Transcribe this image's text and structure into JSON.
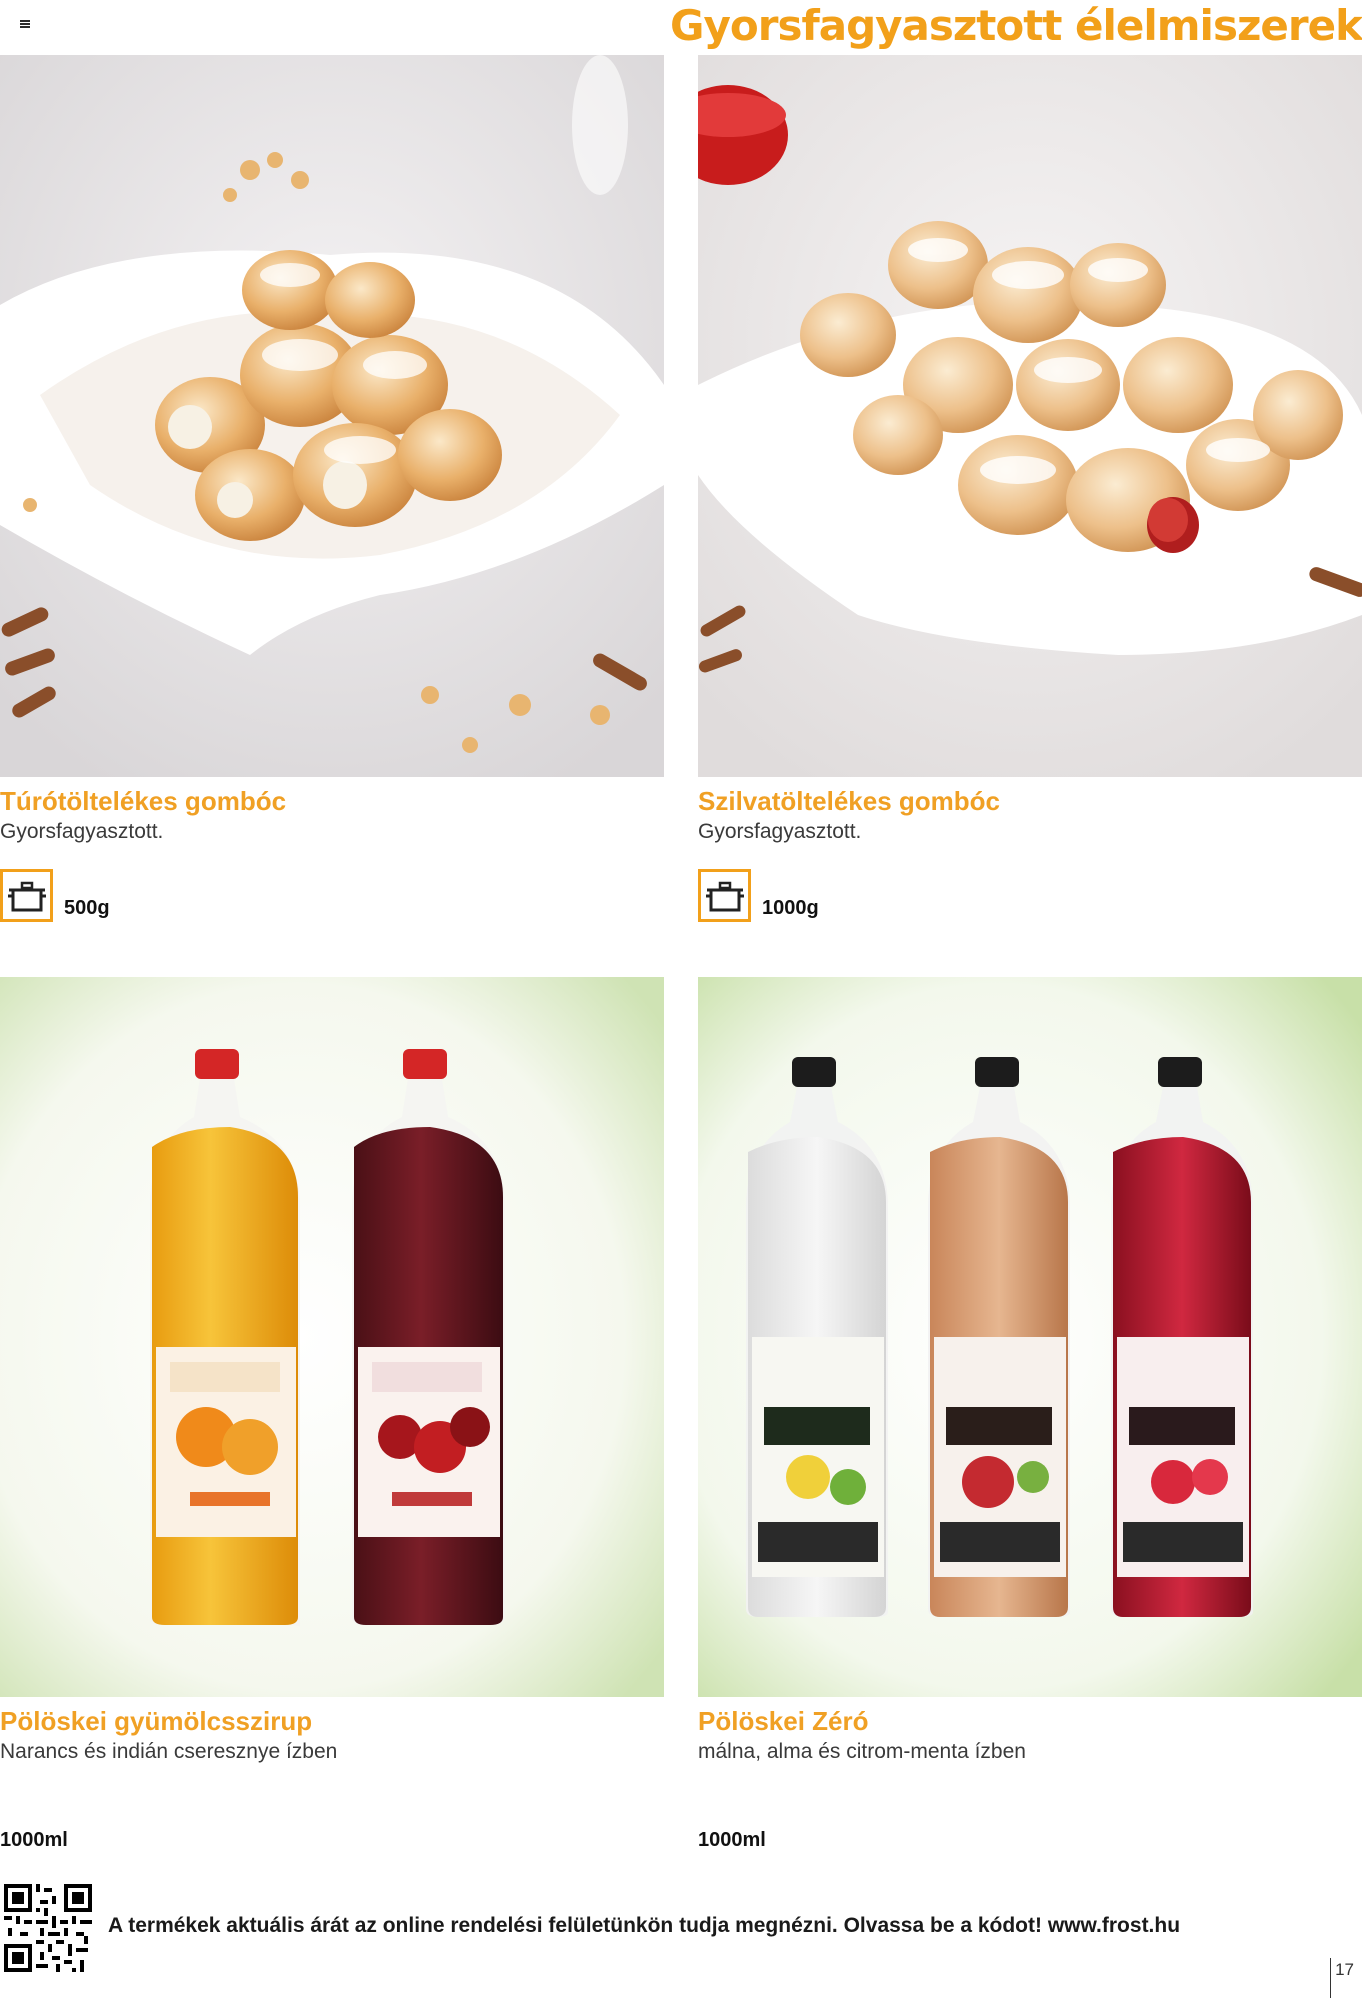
{
  "header": {
    "title": "Gyorsfagyasztott élelmiszerek"
  },
  "products": [
    {
      "name": "Túrótöltelékes gombóc",
      "description": "Gyorsfagyasztott.",
      "size": "500g",
      "icon": "cooking-pot-icon"
    },
    {
      "name": "Szilvatöltelékes gombóc",
      "description": "Gyorsfagyasztott.",
      "size": "1000g",
      "icon": "cooking-pot-icon"
    },
    {
      "name": "Pölöskei gyümölcsszirup",
      "description": "Narancs és indián cseresznye ízben",
      "size": "1000ml"
    },
    {
      "name": "Pölöskei Zéró",
      "description": "málna, alma és citrom-menta ízben",
      "size": "1000ml"
    }
  ],
  "footer": {
    "note": "A termékek aktuális árát az online rendelési felületünkön tudja megnézni. Olvassa be a kódot! www.frost.hu",
    "page_number": "17"
  },
  "colors": {
    "accent": "#f2a01a"
  }
}
